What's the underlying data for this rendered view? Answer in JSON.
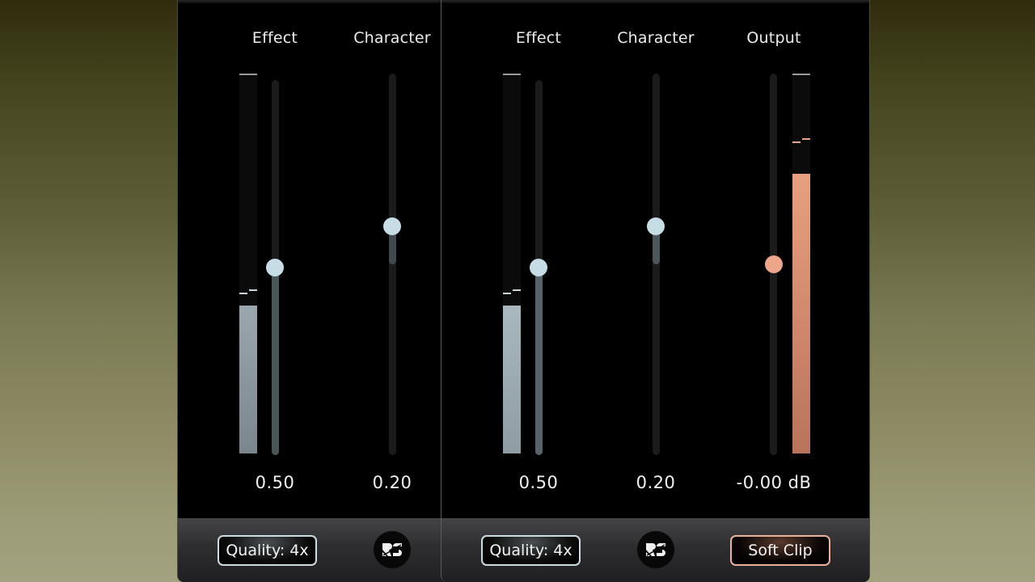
{
  "colors": {
    "accent_blue": "#c6dde6",
    "accent_peach": "#eea68a",
    "panel_bg": "#000000"
  },
  "plugins": [
    {
      "id": "left",
      "controls": [
        {
          "label": "Effect",
          "value_text": "0.50",
          "value": 0.5,
          "meter_level": 0.39,
          "meter_peak": 0.43
        },
        {
          "label": "Character",
          "value_text": "0.20",
          "value": 0.2
        }
      ],
      "footer": {
        "quality_label": "Quality: 4x",
        "logo_icon": "rs-logo-icon"
      }
    },
    {
      "id": "right",
      "controls": [
        {
          "label": "Effect",
          "value_text": "0.50",
          "value": 0.5,
          "meter_level": 0.39,
          "meter_peak": 0.43
        },
        {
          "label": "Character",
          "value_text": "0.20",
          "value": 0.2
        },
        {
          "label": "Output",
          "value_text": "-0.00 dB",
          "value": 0.5,
          "meter_level": 0.74,
          "meter_peak": 0.83
        }
      ],
      "footer": {
        "quality_label": "Quality: 4x",
        "logo_icon": "rs-logo-icon",
        "clip_label": "Soft Clip"
      }
    }
  ]
}
